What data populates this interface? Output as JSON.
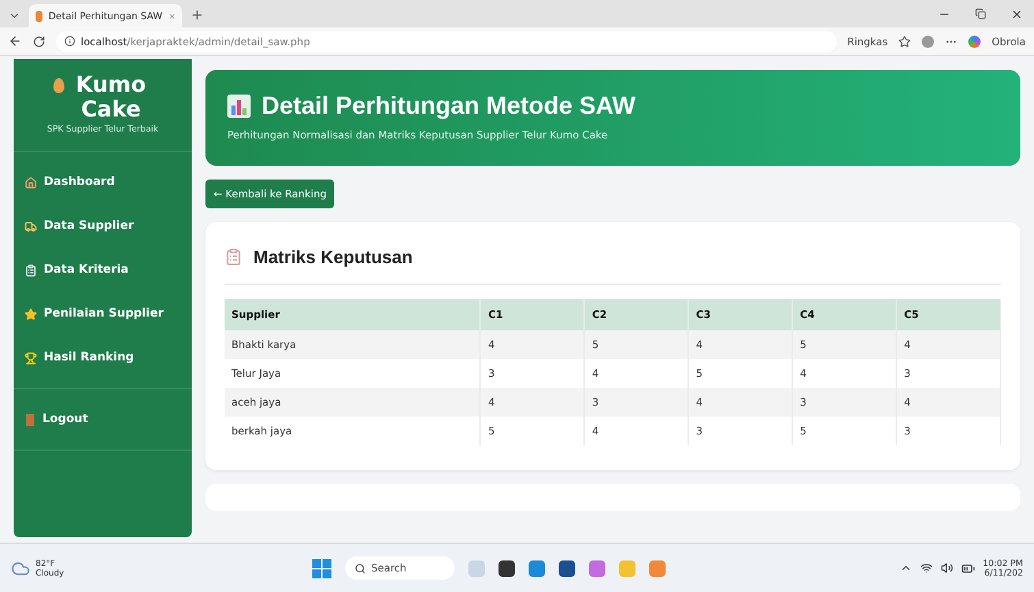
{
  "browser": {
    "tab_title": "Detail Perhitungan SAW",
    "url_host": "localhost",
    "url_path": "/kerjapraktek/admin/detail_saw.php",
    "summarize_label": "Ringkas",
    "copilot_label": "Obrola"
  },
  "sidebar": {
    "brand": "Kumo Cake",
    "tagline": "SPK Supplier Telur Terbaik",
    "items": [
      {
        "label": "Dashboard",
        "kind": "home"
      },
      {
        "label": "Data Supplier",
        "kind": "truck"
      },
      {
        "label": "Data Kriteria",
        "kind": "clipboard"
      },
      {
        "label": "Penilaian Supplier",
        "kind": "star"
      },
      {
        "label": "Hasil Ranking",
        "kind": "trophy"
      }
    ],
    "logout": "Logout"
  },
  "header": {
    "title": "Detail Perhitungan Metode SAW",
    "subtitle": "Perhitungan Normalisasi dan Matriks Keputusan Supplier Telur Kumo Cake"
  },
  "back_button": "← Kembali ke Ranking",
  "matrix": {
    "title": "Matriks Keputusan",
    "columns": [
      "Supplier",
      "C1",
      "C2",
      "C3",
      "C4",
      "C5"
    ],
    "rows": [
      [
        "Bhakti karya",
        "4",
        "5",
        "4",
        "5",
        "4"
      ],
      [
        "Telur Jaya",
        "3",
        "4",
        "5",
        "4",
        "3"
      ],
      [
        "aceh jaya",
        "4",
        "3",
        "4",
        "3",
        "4"
      ],
      [
        "berkah jaya",
        "5",
        "4",
        "3",
        "5",
        "3"
      ]
    ]
  },
  "taskbar": {
    "temperature": "82°F",
    "weather": "Cloudy",
    "search_placeholder": "Search",
    "time": "10:02 PM",
    "date": "6/11/202"
  }
}
